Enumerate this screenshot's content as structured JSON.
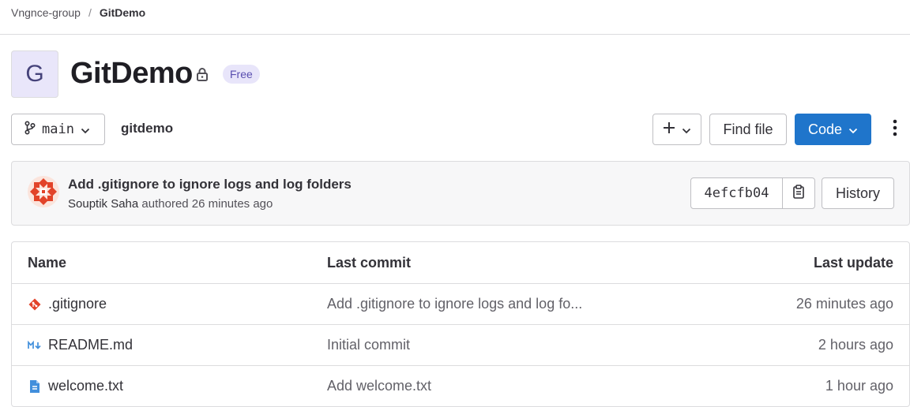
{
  "breadcrumb": {
    "group": "Vngnce-group",
    "separator": "/",
    "project": "GitDemo"
  },
  "project": {
    "avatar_letter": "G",
    "name": "GitDemo",
    "visibility_icon": "lock-icon",
    "badge": "Free"
  },
  "toolbar": {
    "branch": "main",
    "path": "gitdemo",
    "add_icon": "plus-icon",
    "find_file_label": "Find file",
    "code_label": "Code",
    "more_icon": "kebab-icon"
  },
  "last_commit": {
    "title": "Add .gitignore to ignore logs and log folders",
    "author": "Souptik Saha",
    "authored_text": "authored 26 minutes ago",
    "sha": "4efcfb04",
    "history_label": "History"
  },
  "file_table": {
    "columns": [
      "Name",
      "Last commit",
      "Last update"
    ],
    "rows": [
      {
        "name": ".gitignore",
        "icon": "git-icon",
        "commit": "Add .gitignore to ignore logs and log fo...",
        "updated": "26 minutes ago"
      },
      {
        "name": "README.md",
        "icon": "markdown-icon",
        "commit": "Initial commit",
        "updated": "2 hours ago"
      },
      {
        "name": "welcome.txt",
        "icon": "text-file-icon",
        "commit": "Add welcome.txt",
        "updated": "1 hour ago"
      }
    ]
  },
  "colors": {
    "primary": "#1f75cb",
    "badge_bg": "#e8e5fa",
    "badge_text": "#5a4fb0",
    "git_icon": "#e24329",
    "markdown_icon": "#428fdc",
    "text_file_icon": "#428fdc"
  }
}
